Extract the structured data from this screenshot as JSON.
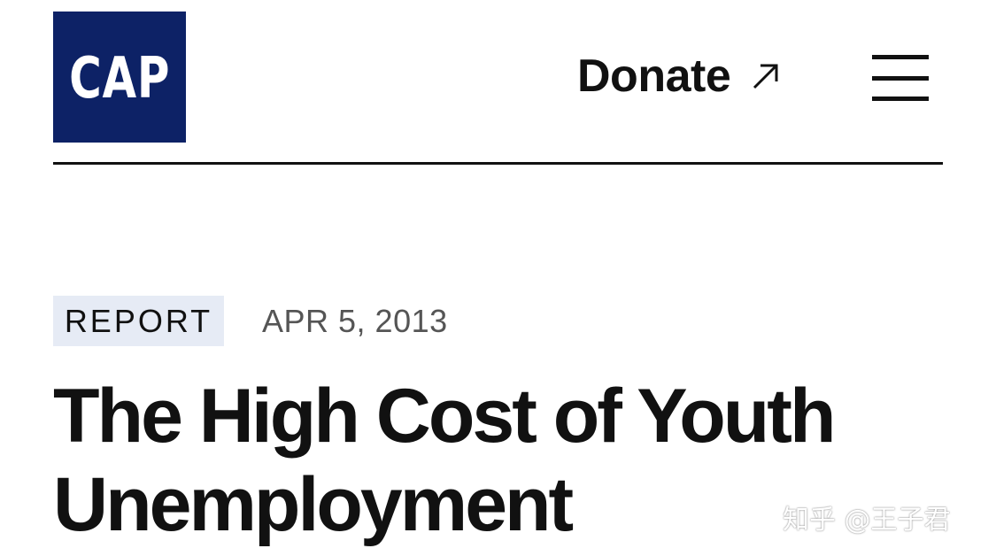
{
  "header": {
    "logo_text": "CAP",
    "donate_label": "Donate",
    "donate_icon": "arrow-up-right-icon",
    "menu_icon": "hamburger-menu-icon",
    "logo_color": "#0d2266"
  },
  "article": {
    "badge": "REPORT",
    "date": "APR 5, 2013",
    "title": "The High Cost of Youth Unemployment",
    "badge_color": "#e6ebf5"
  },
  "watermark": {
    "text": "知乎 @王子君"
  }
}
